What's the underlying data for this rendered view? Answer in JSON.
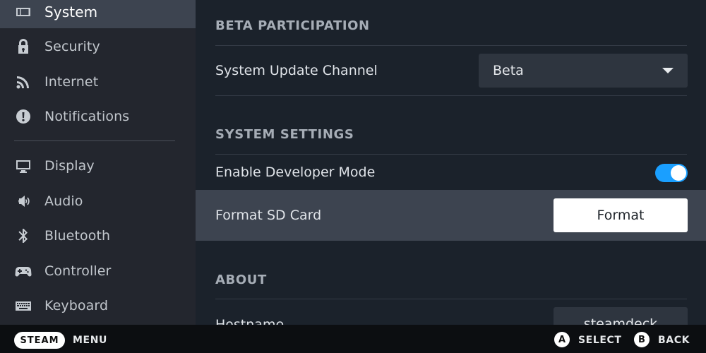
{
  "sidebar": {
    "items": [
      {
        "label": "System",
        "icon": "system-icon",
        "active": true
      },
      {
        "label": "Security",
        "icon": "lock-icon"
      },
      {
        "label": "Internet",
        "icon": "wifi-signal-icon"
      },
      {
        "label": "Notifications",
        "icon": "alert-icon"
      },
      {
        "label": "Display",
        "icon": "monitor-icon"
      },
      {
        "label": "Audio",
        "icon": "speaker-icon"
      },
      {
        "label": "Bluetooth",
        "icon": "bluetooth-icon"
      },
      {
        "label": "Controller",
        "icon": "gamepad-icon"
      },
      {
        "label": "Keyboard",
        "icon": "keyboard-icon"
      }
    ]
  },
  "main": {
    "beta": {
      "header": "BETA PARTICIPATION",
      "update_channel_label": "System Update Channel",
      "update_channel_value": "Beta"
    },
    "system_settings": {
      "header": "SYSTEM SETTINGS",
      "dev_mode_label": "Enable Developer Mode",
      "dev_mode_enabled": true,
      "format_sd_label": "Format SD Card",
      "format_button": "Format"
    },
    "about": {
      "header": "ABOUT",
      "hostname_label": "Hostname",
      "hostname_value": "steamdeck"
    }
  },
  "footer": {
    "steam_button": "STEAM",
    "menu_label": "MENU",
    "a_button": "A",
    "select_label": "SELECT",
    "b_button": "B",
    "back_label": "BACK"
  },
  "colors": {
    "accent": "#1a9fff",
    "sidebar_bg": "#23262e",
    "main_bg": "#1b222b",
    "highlight": "#3d4450"
  }
}
